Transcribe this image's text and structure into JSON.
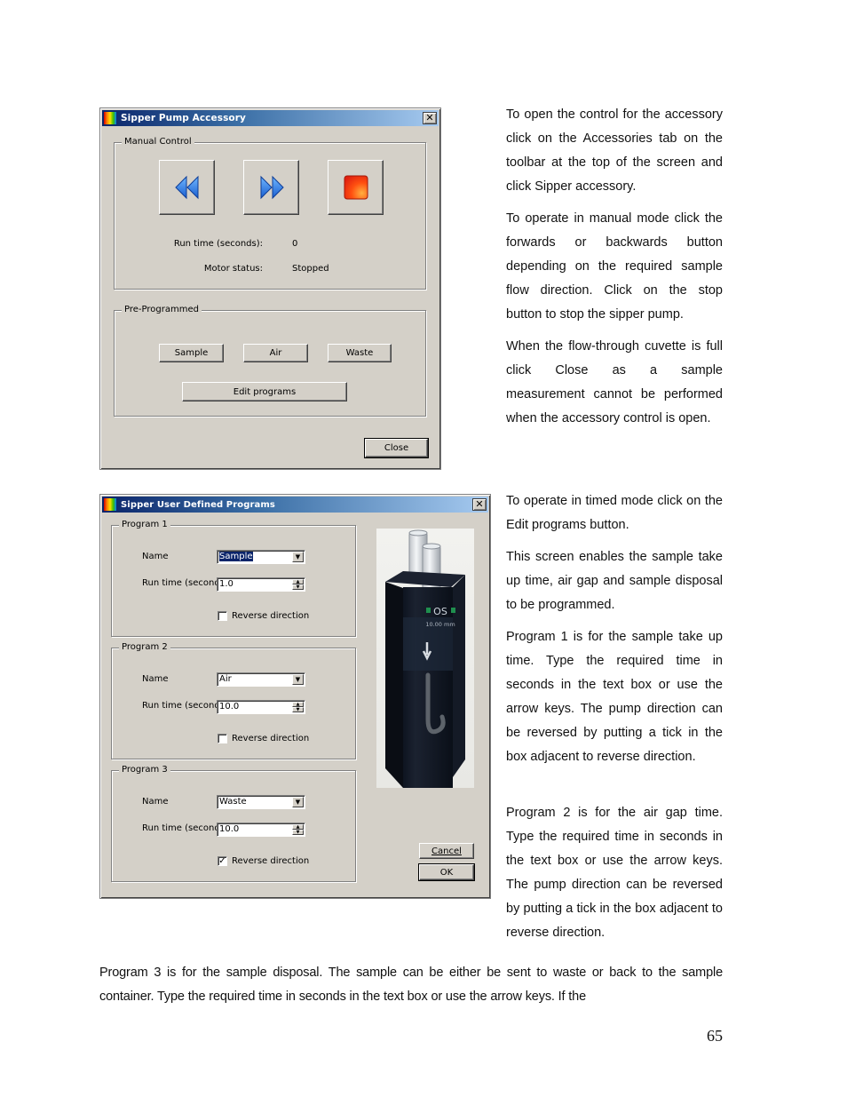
{
  "dialog1": {
    "title": "Sipper Pump Accessory",
    "close_glyph": "✕",
    "manual_group_label": "Manual Control",
    "media_buttons": [
      {
        "name": "backward",
        "icon": "rewind-icon"
      },
      {
        "name": "forward",
        "icon": "fast-forward-icon"
      },
      {
        "name": "stop",
        "icon": "stop-icon"
      }
    ],
    "run_time_label": "Run time (seconds):",
    "run_time_value": "0",
    "motor_status_label": "Motor status:",
    "motor_status_value": "Stopped",
    "preprog_group_label": "Pre-Programmed",
    "sample_button": "Sample",
    "air_button": "Air",
    "waste_button": "Waste",
    "edit_programs_button": "Edit programs",
    "close_button": "Close"
  },
  "dialog2": {
    "title": "Sipper User Defined Programs",
    "close_glyph": "✕",
    "programs": [
      {
        "group_label": "Program 1",
        "name_label": "Name",
        "name_value": "Sample",
        "run_time_label": "Run time (seconds)",
        "run_time_value": "1.0",
        "reverse_label": "Reverse direction",
        "reverse_checked": false
      },
      {
        "group_label": "Program 2",
        "name_label": "Name",
        "name_value": "Air",
        "run_time_label": "Run time (seconds)",
        "run_time_value": "10.0",
        "reverse_label": "Reverse direction",
        "reverse_checked": false
      },
      {
        "group_label": "Program 3",
        "name_label": "Name",
        "name_value": "Waste",
        "run_time_label": "Run time (seconds)",
        "run_time_value": "10.0",
        "reverse_label": "Reverse direction",
        "reverse_checked": true
      }
    ],
    "photo": {
      "cuvette_label": "OS",
      "cuvette_size": "10.00 mm"
    },
    "cancel_button": "Cancel",
    "ok_button": "OK"
  },
  "text": {
    "p1": "To open the control for the accessory click on the Accessories tab on the toolbar at the top of the screen and click Sipper accessory.",
    "p2": "To operate in manual mode click the forwards or backwards button depending on the required sample flow direction. Click on the stop button to stop the sipper pump.",
    "p3": "When the flow-through cuvette is full click Close as a sample measurement cannot be performed when the accessory control is open.",
    "p4": "To operate in timed mode click on the Edit programs button.",
    "p5": "This screen enables the sample take up time, air gap and sample disposal to be programmed.",
    "p6": "Program 1 is for the sample take up time. Type the required time in seconds in the text box or use the arrow keys. The pump direction can be reversed by putting a tick in the box adjacent to reverse direction.",
    "p7": "Program 2 is for the air gap time. Type the required time in seconds in the text box or use the arrow keys. The pump direction can be reversed by putting a tick in the box adjacent to reverse direction.",
    "p8": "Program 3 is for the sample disposal. The sample can be either be sent to waste or back to the sample container. Type the required time in seconds in the text box or use the arrow keys. If the"
  },
  "page_number": "65"
}
